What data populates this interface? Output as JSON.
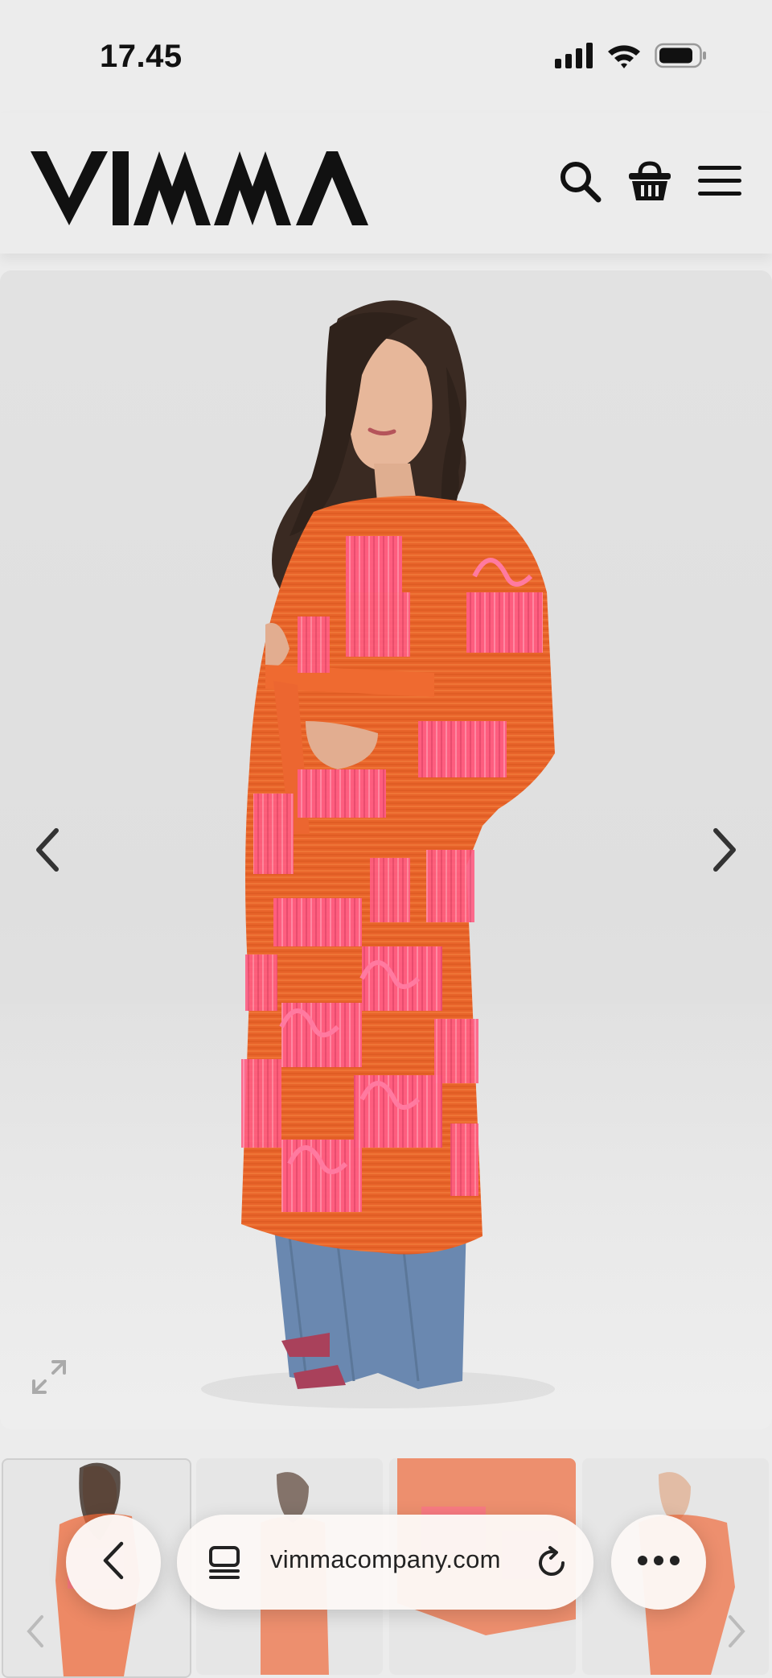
{
  "status_bar": {
    "time": "17.45",
    "icons": [
      "signal-icon",
      "wifi-icon",
      "battery-icon"
    ]
  },
  "header": {
    "logo_text": "VIMMA",
    "icons": [
      "search-icon",
      "basket-icon",
      "menu-icon"
    ]
  },
  "gallery": {
    "prev_icon": "chevron-left-icon",
    "next_icon": "chevron-right-icon",
    "expand_icon": "expand-icon",
    "thumbnail_count": 4,
    "selected_thumbnail": 1
  },
  "browser": {
    "url": "vimmacompany.com",
    "back_icon": "back-icon",
    "tabs_icon": "tabs-icon",
    "reload_icon": "reload-icon",
    "more_icon": "more-icon"
  },
  "colors": {
    "background": "#ececec",
    "garment_orange": "#e8642a",
    "fringe_pink": "#ff5c86",
    "jeans_blue": "#6a88b0"
  }
}
